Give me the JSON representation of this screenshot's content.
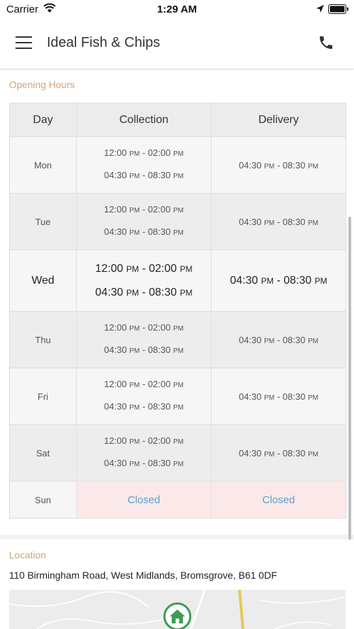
{
  "status_bar": {
    "carrier": "Carrier",
    "time": "1:29 AM"
  },
  "header": {
    "title": "Ideal Fish & Chips",
    "menu_icon": "hamburger-menu-icon",
    "phone_icon": "phone-icon"
  },
  "opening_hours": {
    "heading": "Opening Hours",
    "columns": [
      "Day",
      "Collection",
      "Delivery"
    ],
    "rows": [
      {
        "day": "Mon",
        "c1": "12:00",
        "c1p": "PM",
        "c2": "02:00",
        "c2p": "PM",
        "c3": "04:30",
        "c3p": "PM",
        "c4": "08:30",
        "c4p": "PM",
        "d1": "04:30",
        "d1p": "PM",
        "d2": "08:30",
        "d2p": "PM"
      },
      {
        "day": "Tue",
        "c1": "12:00",
        "c1p": "PM",
        "c2": "02:00",
        "c2p": "PM",
        "c3": "04:30",
        "c3p": "PM",
        "c4": "08:30",
        "c4p": "PM",
        "d1": "04:30",
        "d1p": "PM",
        "d2": "08:30",
        "d2p": "PM"
      },
      {
        "day": "Wed",
        "c1": "12:00",
        "c1p": "PM",
        "c2": "02:00",
        "c2p": "PM",
        "c3": "04:30",
        "c3p": "PM",
        "c4": "08:30",
        "c4p": "PM",
        "d1": "04:30",
        "d1p": "PM",
        "d2": "08:30",
        "d2p": "PM"
      },
      {
        "day": "Thu",
        "c1": "12:00",
        "c1p": "PM",
        "c2": "02:00",
        "c2p": "PM",
        "c3": "04:30",
        "c3p": "PM",
        "c4": "08:30",
        "c4p": "PM",
        "d1": "04:30",
        "d1p": "PM",
        "d2": "08:30",
        "d2p": "PM"
      },
      {
        "day": "Fri",
        "c1": "12:00",
        "c1p": "PM",
        "c2": "02:00",
        "c2p": "PM",
        "c3": "04:30",
        "c3p": "PM",
        "c4": "08:30",
        "c4p": "PM",
        "d1": "04:30",
        "d1p": "PM",
        "d2": "08:30",
        "d2p": "PM"
      },
      {
        "day": "Sat",
        "c1": "12:00",
        "c1p": "PM",
        "c2": "02:00",
        "c2p": "PM",
        "c3": "04:30",
        "c3p": "PM",
        "c4": "08:30",
        "c4p": "PM",
        "d1": "04:30",
        "d1p": "PM",
        "d2": "08:30",
        "d2p": "PM"
      }
    ],
    "sunday": {
      "day": "Sun",
      "collection": "Closed",
      "delivery": "Closed"
    }
  },
  "location": {
    "heading": "Location",
    "address": "110 Birmingham Road, West Midlands, Bromsgrove, B61 0DF",
    "map_pin_icon": "home-pin-icon"
  },
  "colors": {
    "heading_accent": "#c8a87e",
    "closed_text": "#5a9fc7",
    "closed_bg": "#fbe9ea",
    "map_pin": "#3f9b55"
  }
}
